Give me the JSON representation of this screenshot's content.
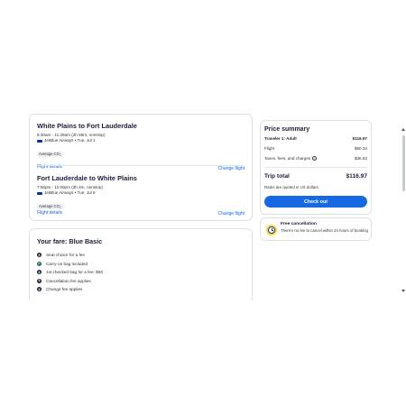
{
  "flights": [
    {
      "title": "White Plains to Fort Lauderdale",
      "times": "8:30am - 11:29am (2h 59m, nonstop)",
      "airline": "JetBlue Airways • Tue, Jul 1",
      "co2": "Average CO₂",
      "details_link": "Flight details",
      "change_link": "Change flight"
    },
    {
      "title": "Fort Lauderdale to White Plains",
      "times": "7:56pm - 11:00pm (3h 4m, nonstop)",
      "airline": "JetBlue Airways • Tue, Jul 8",
      "co2": "Average CO₂",
      "details_link": "Flight details",
      "change_link": "Change flight"
    }
  ],
  "fare": {
    "title": "Your fare: Blue Basic",
    "items": [
      {
        "label": "Seat choice for a fee",
        "icon": "dollar-icon"
      },
      {
        "label": "Carry-on bag included",
        "icon": "check-icon"
      },
      {
        "label": "1st checked bag for a fee: $50",
        "icon": "dollar-icon"
      },
      {
        "label": "Cancellation fee applies",
        "icon": "dollar-icon"
      },
      {
        "label": "Change fee applies",
        "icon": "dollar-icon"
      }
    ]
  },
  "price_summary": {
    "title": "Price summary",
    "traveler_label": "Traveler 1: Adult",
    "traveler_value": "$116.97",
    "flight_label": "Flight",
    "flight_value": "$80.34",
    "taxes_label": "Taxes, fees, and charges",
    "taxes_value": "$36.63",
    "total_label": "Trip total",
    "total_value": "$116.97",
    "note": "Rates are quoted in US dollars",
    "checkout_label": "Check out"
  },
  "cancellation": {
    "title": "Free cancellation",
    "description": "There's no fee to cancel within 24 hours of booking"
  },
  "colors": {
    "accent": "#1668e3",
    "text": "#191e3b",
    "success": "#227950",
    "clock_yellow": "#fdd835"
  }
}
